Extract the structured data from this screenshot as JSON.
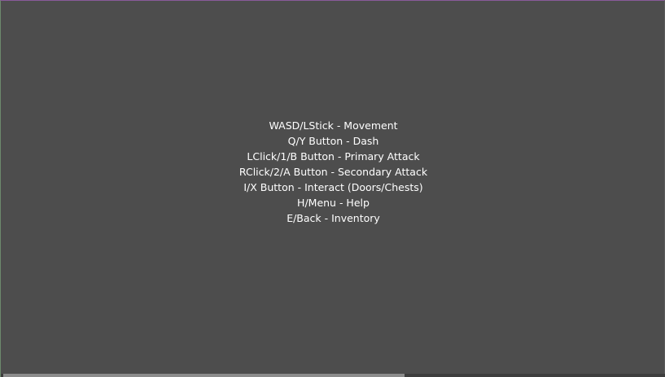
{
  "help": {
    "lines": [
      "WASD/LStick - Movement",
      "Q/Y Button - Dash",
      "LClick/1/B Button - Primary Attack",
      "RClick/2/A Button - Secondary Attack",
      "I/X Button - Interact (Doors/Chests)",
      "H/Menu - Help",
      "E/Back - Inventory"
    ]
  },
  "colors": {
    "background": "#4d4d4d",
    "text": "#ffffff"
  }
}
